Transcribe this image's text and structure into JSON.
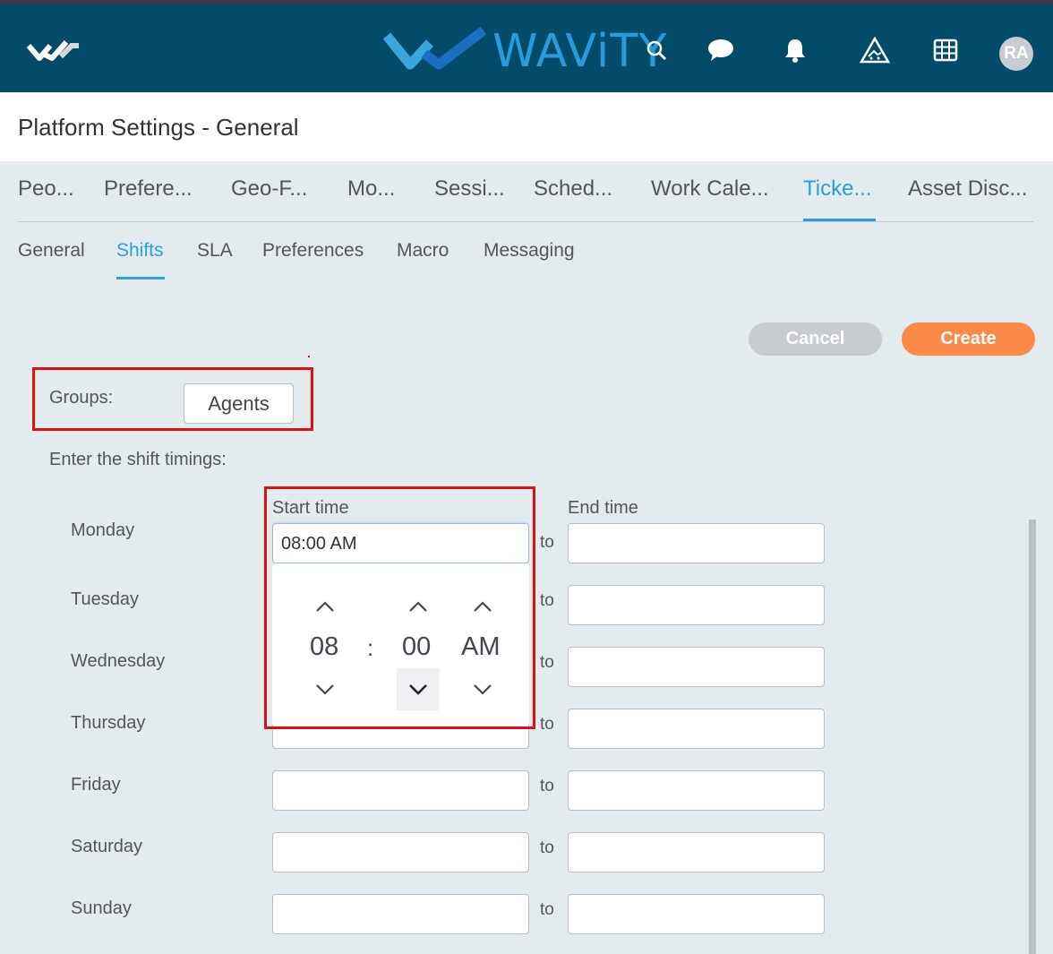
{
  "header": {
    "brand": "WAViTY",
    "avatar_initials": "RA",
    "icons": [
      "logo-check-icon",
      "search-icon",
      "chat-icon",
      "bell-icon",
      "alert-icon",
      "grid-icon"
    ]
  },
  "page": {
    "title": "Platform Settings - General"
  },
  "tabs": [
    {
      "label": "Peo..."
    },
    {
      "label": "Prefere..."
    },
    {
      "label": "Geo-F..."
    },
    {
      "label": "Mo..."
    },
    {
      "label": "Sessi..."
    },
    {
      "label": "Sched..."
    },
    {
      "label": "Work Cale..."
    },
    {
      "label": "Ticke...",
      "active": true
    },
    {
      "label": "Asset Disc..."
    }
  ],
  "subtabs": [
    {
      "label": "General"
    },
    {
      "label": "Shifts",
      "active": true
    },
    {
      "label": "SLA"
    },
    {
      "label": "Preferences"
    },
    {
      "label": "Macro"
    },
    {
      "label": "Messaging"
    }
  ],
  "actions": {
    "cancel_label": "Cancel",
    "create_label": "Create"
  },
  "groups": {
    "label": "Groups:",
    "value": "Agents"
  },
  "shift": {
    "instructions": "Enter the shift timings:",
    "start_header": "Start time",
    "end_header": "End time",
    "to_label": "to",
    "days": [
      {
        "name": "Monday",
        "start": "08:00 AM",
        "end": ""
      },
      {
        "name": "Tuesday",
        "start": "",
        "end": ""
      },
      {
        "name": "Wednesday",
        "start": "",
        "end": ""
      },
      {
        "name": "Thursday",
        "start": "",
        "end": ""
      },
      {
        "name": "Friday",
        "start": "",
        "end": ""
      },
      {
        "name": "Saturday",
        "start": "",
        "end": ""
      },
      {
        "name": "Sunday",
        "start": "",
        "end": ""
      }
    ]
  },
  "time_picker": {
    "hour": "08",
    "separator": ":",
    "minute": "00",
    "period": "AM"
  },
  "colors": {
    "header_bg": "#024b69",
    "accent": "#2b9fd6",
    "create_btn": "#fd8a49",
    "cancel_btn": "#c9cccf",
    "highlight": "#e01010"
  }
}
